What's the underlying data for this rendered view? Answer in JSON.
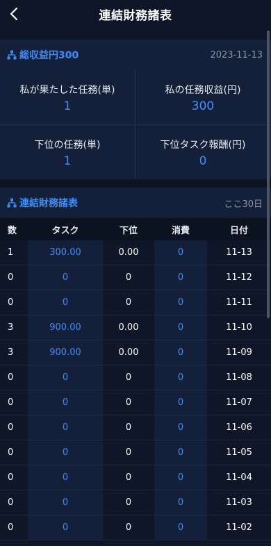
{
  "header": {
    "title": "連結財務諸表"
  },
  "summary": {
    "heading": "総収益円300",
    "date": "2023-11-13",
    "cells": [
      {
        "label": "私が果たした任務(単)",
        "value": "1"
      },
      {
        "label": "私の任務収益(円)",
        "value": "300"
      },
      {
        "label": "下位の任務(単)",
        "value": "1"
      },
      {
        "label": "下位タスク報酬(円)",
        "value": "0"
      }
    ]
  },
  "report": {
    "heading": "連結財務諸表",
    "period": "ここ30日",
    "columns": [
      "数",
      "タスク",
      "下位",
      "消費",
      "日付"
    ],
    "rows": [
      {
        "count": "1",
        "task": "300.00",
        "sub": "0.00",
        "spend": "0",
        "date": "11-13"
      },
      {
        "count": "0",
        "task": "0",
        "sub": "0",
        "spend": "0",
        "date": "11-12"
      },
      {
        "count": "0",
        "task": "0",
        "sub": "0",
        "spend": "0",
        "date": "11-11"
      },
      {
        "count": "3",
        "task": "900.00",
        "sub": "0.00",
        "spend": "0",
        "date": "11-10"
      },
      {
        "count": "3",
        "task": "900.00",
        "sub": "0.00",
        "spend": "0",
        "date": "11-09"
      },
      {
        "count": "0",
        "task": "0",
        "sub": "0",
        "spend": "0",
        "date": "11-08"
      },
      {
        "count": "0",
        "task": "0",
        "sub": "0",
        "spend": "0",
        "date": "11-07"
      },
      {
        "count": "0",
        "task": "0",
        "sub": "0",
        "spend": "0",
        "date": "11-06"
      },
      {
        "count": "0",
        "task": "0",
        "sub": "0",
        "spend": "0",
        "date": "11-05"
      },
      {
        "count": "0",
        "task": "0",
        "sub": "0",
        "spend": "0",
        "date": "11-04"
      },
      {
        "count": "0",
        "task": "0",
        "sub": "0",
        "spend": "0",
        "date": "11-03"
      },
      {
        "count": "0",
        "task": "0",
        "sub": "0",
        "spend": "0",
        "date": "11-02"
      }
    ]
  },
  "colors": {
    "accent": "#3e8ef7",
    "background": "#0e1627",
    "panel": "#142039"
  },
  "icons": {
    "back": "chevron-left-icon",
    "section": "hierarchy-icon"
  }
}
